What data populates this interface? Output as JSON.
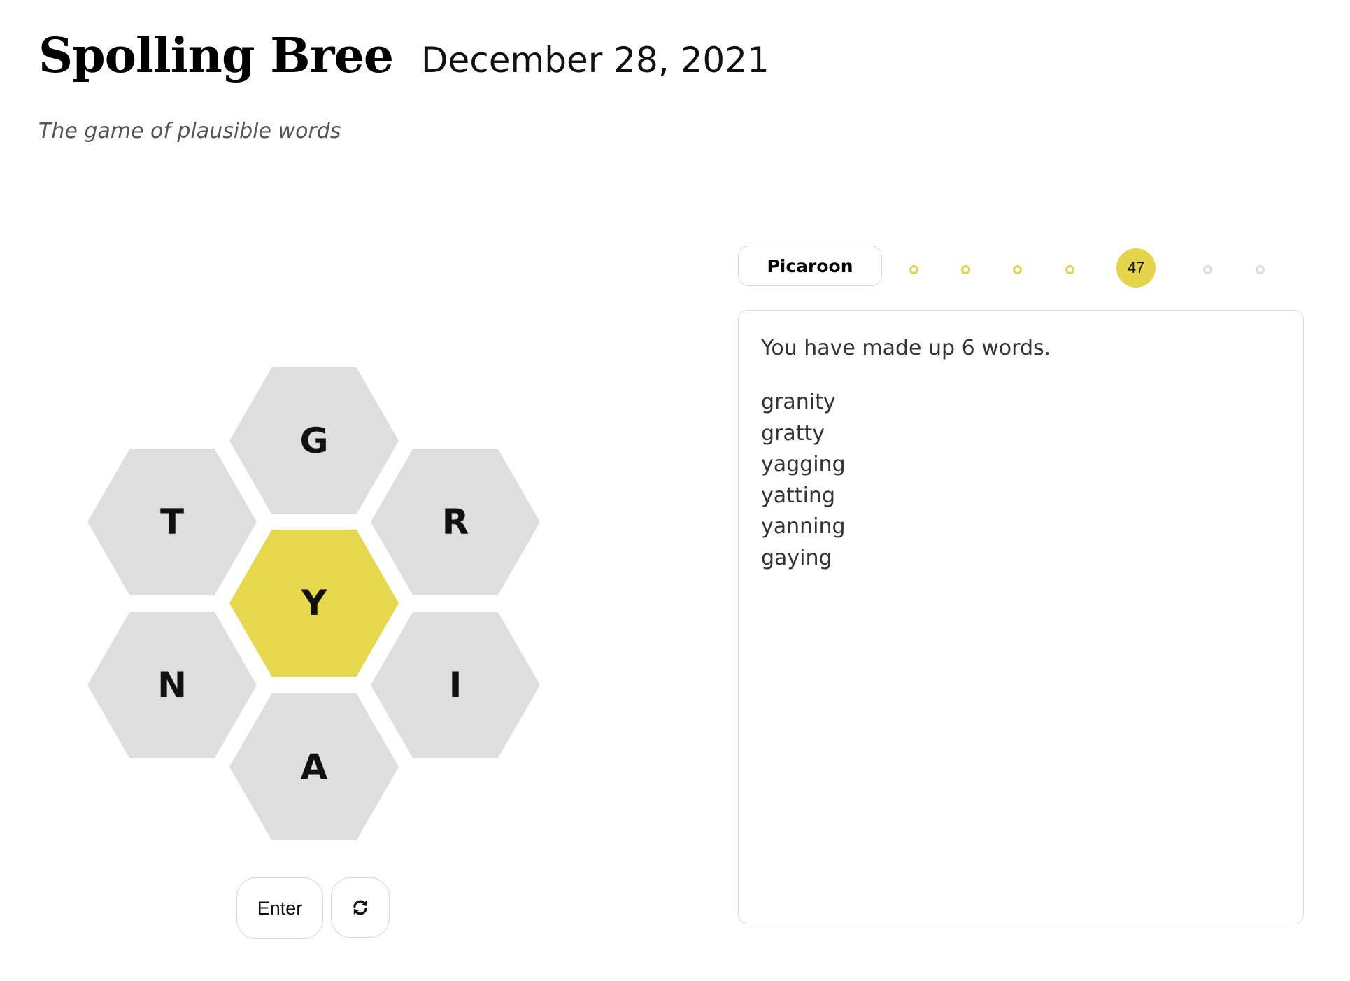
{
  "header": {
    "title": "Spolling Bree",
    "date": "December 28, 2021",
    "subtitle": "The game of plausible words"
  },
  "hive": {
    "center": "Y",
    "outer": {
      "top": "G",
      "upper_left": "T",
      "upper_right": "R",
      "lower_left": "N",
      "lower_right": "I",
      "bottom": "A"
    },
    "center_color": "#e6d74c",
    "outer_color": "#dedede"
  },
  "controls": {
    "enter_label": "Enter",
    "shuffle_icon": "shuffle-icon"
  },
  "progress": {
    "rank": "Picaroon",
    "score": "47",
    "achieved_color": "#e3d44a",
    "pending_color": "#dcdcdc"
  },
  "found": {
    "summary": "You have made up 6 words.",
    "words": [
      "granity",
      "gratty",
      "yagging",
      "yatting",
      "yanning",
      "gaying"
    ]
  }
}
